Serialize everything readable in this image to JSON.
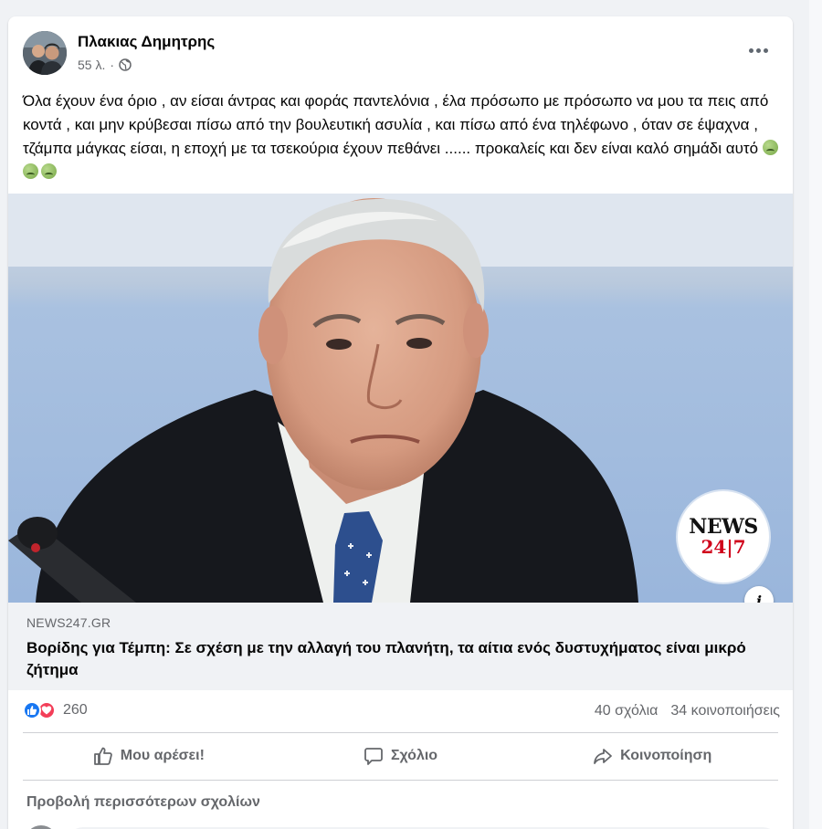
{
  "post": {
    "author": "Πλακιας Δημητρης",
    "time": "55 λ.",
    "privacy_icon": "globe-icon",
    "menu_icon": "more-icon",
    "text_1": "Όλα έχουν ένα όριο , αν είσαι άντρας και φοράς παντελόνια , έλα πρόσωπο με πρόσωπο να μου τα πεις από κοντά , και μην κρύβεσαι πίσω από την βουλευτική ασυλία , και πίσω από ένα τηλέφωνο , όταν σε έψαχνα , τζάμπα μάγκας είσαι, η εποχή με τα τσεκούρια έχουν πεθάνει ...... προκαλείς και δεν είναι καλό σημάδι αυτό",
    "emoji_count": 3
  },
  "link": {
    "logo_line1": "NEWS",
    "logo_line2": "24|7",
    "domain": "NEWS247.GR",
    "title": "Βορίδης για Τέμπη: Σε σχέση με την αλλαγή του πλανήτη, τα αίτια ενός δυστυχήματος είναι μικρό ζήτημα",
    "info_label": "i"
  },
  "stats": {
    "reactions": "260",
    "comments": "40 σχόλια",
    "shares": "34 κοινοποιήσεις"
  },
  "actions": {
    "like": "Μου αρέσει!",
    "comment": "Σχόλιο",
    "share": "Κοινοποίηση"
  },
  "comments": {
    "view_more": "Προβολή περισσότερων σχολίων"
  },
  "colors": {
    "like_blue": "#1877f2",
    "love_red": "#f33e58",
    "secondary_text": "#65676b",
    "logo_red": "#d0021b"
  }
}
